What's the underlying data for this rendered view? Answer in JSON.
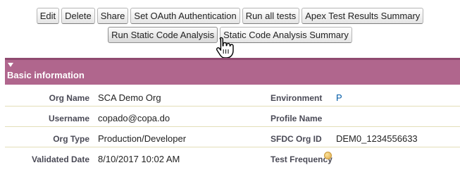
{
  "toolbar": {
    "row1": [
      "Edit",
      "Delete",
      "Share",
      "Set OAuth Authentication",
      "Run all tests",
      "Apex Test Results Summary"
    ],
    "row2": [
      "Run Static Code Analysis",
      "Static Code Analysis Summary"
    ]
  },
  "section": {
    "title": "Basic information"
  },
  "fields": {
    "org_name": {
      "label": "Org Name",
      "value": "SCA Demo Org"
    },
    "environment": {
      "label": "Environment",
      "value": "P"
    },
    "username": {
      "label": "Username",
      "value": "copado@copa.do"
    },
    "profile_name": {
      "label": "Profile Name",
      "value": ""
    },
    "org_type": {
      "label": "Org Type",
      "value": "Production/Developer"
    },
    "sfdc_org_id": {
      "label": "SFDC Org ID",
      "value": "DEM0_1234556633"
    },
    "validated_date": {
      "label": "Validated Date",
      "value": "8/10/2017 10:02 AM"
    },
    "test_frequency": {
      "label": "Test Frequency",
      "value": ""
    }
  },
  "icons": {
    "section_toggle": "triangle-down-icon",
    "cursor": "hand-pointer-icon",
    "help": "help-bubble-icon"
  },
  "colors": {
    "section_header": "#b0668d",
    "link": "#015ba7",
    "row_divider": "#e3deb8"
  }
}
